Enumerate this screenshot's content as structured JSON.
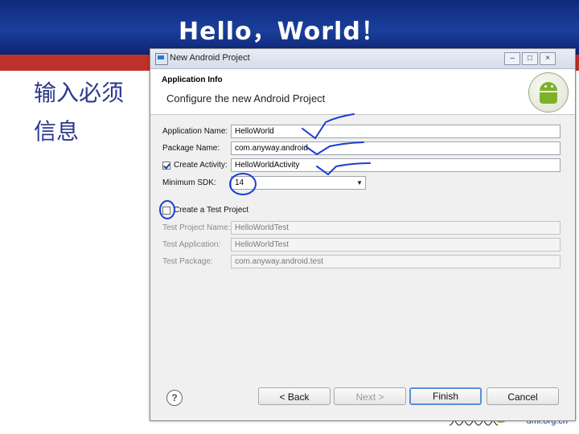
{
  "slide": {
    "title": "Hello，World！",
    "note_line1": "输入必须",
    "note_line2": "信息",
    "site": "uml.org.cn",
    "figures": "人人人人人"
  },
  "dialog": {
    "title": "New Android Project",
    "banner_title": "Application Info",
    "banner_desc": "Configure the new Android Project",
    "fields": {
      "app_name": {
        "label": "Application Name:",
        "value": "HelloWorld"
      },
      "package_name": {
        "label": "Package Name:",
        "value": "com.anyway.android"
      },
      "create_activity": {
        "label": "Create Activity:",
        "value": "HelloWorldActivity",
        "checked": true
      },
      "min_sdk": {
        "label": "Minimum SDK:",
        "value": "14"
      },
      "create_test": {
        "label": "Create a Test Project",
        "checked": false
      },
      "test_project_name": {
        "label": "Test Project Name:",
        "value": "HelloWorldTest"
      },
      "test_application": {
        "label": "Test Application:",
        "value": "HelloWorldTest"
      },
      "test_package": {
        "label": "Test Package:",
        "value": "com.anyway.android.test"
      }
    },
    "buttons": {
      "back": "< Back",
      "next": "Next >",
      "finish": "Finish",
      "cancel": "Cancel"
    }
  },
  "colors": {
    "header_blue": "#1a3f9c",
    "red_band": "#c0302a",
    "ink": "#1c3fd0",
    "android_green": "#7fb02a"
  },
  "icons": [
    "window-icon",
    "android-logo",
    "help-icon",
    "minimize-icon",
    "maximize-icon",
    "close-icon",
    "combo-arrow-icon"
  ]
}
